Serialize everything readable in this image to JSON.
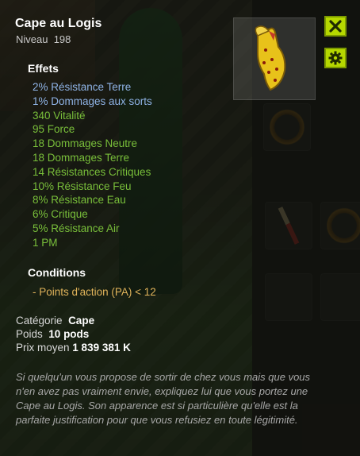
{
  "item": {
    "name": "Cape au Logis",
    "level": "Niveau  198",
    "image_icon": "yellow-cape-icon"
  },
  "effects_title": "Effets",
  "effects": [
    {
      "text": "2% Résistance Terre",
      "color": "#8fb3e6"
    },
    {
      "text": "1% Dommages aux sorts",
      "color": "#8fb3e6"
    },
    {
      "text": "340 Vitalité",
      "color": "#79bf3a"
    },
    {
      "text": "95 Force",
      "color": "#79bf3a"
    },
    {
      "text": "18 Dommages Neutre",
      "color": "#79bf3a"
    },
    {
      "text": "18 Dommages Terre",
      "color": "#79bf3a"
    },
    {
      "text": "14 Résistances Critiques",
      "color": "#79bf3a"
    },
    {
      "text": "10% Résistance Feu",
      "color": "#79bf3a"
    },
    {
      "text": "8% Résistance Eau",
      "color": "#79bf3a"
    },
    {
      "text": "6% Critique",
      "color": "#79bf3a"
    },
    {
      "text": "5% Résistance Air",
      "color": "#79bf3a"
    },
    {
      "text": "1 PM",
      "color": "#79bf3a"
    }
  ],
  "conditions_title": "Conditions",
  "condition": "- Points d'action (PA) < 12",
  "category": {
    "label": "Catégorie",
    "value": "Cape"
  },
  "weight": {
    "label": "Poids",
    "value": "10 pods"
  },
  "price": {
    "label": "Prix moyen",
    "value": "1 839 381 K"
  },
  "description": "Si quelqu'un vous propose de sortir de chez vous mais que vous n'en avez pas vraiment envie, expliquez lui que vous portez une Cape au Logis. Son apparence est si particulière qu'elle est la parfaite justification pour que vous refusiez en toute légitimité.",
  "buttons": {
    "close_icon": "close-icon",
    "settings_icon": "gear-icon"
  },
  "colors": {
    "accent_button": "#b6d800",
    "bonus_effect": "#79bf3a",
    "special_effect": "#8fb3e6",
    "condition": "#e0b35a"
  }
}
